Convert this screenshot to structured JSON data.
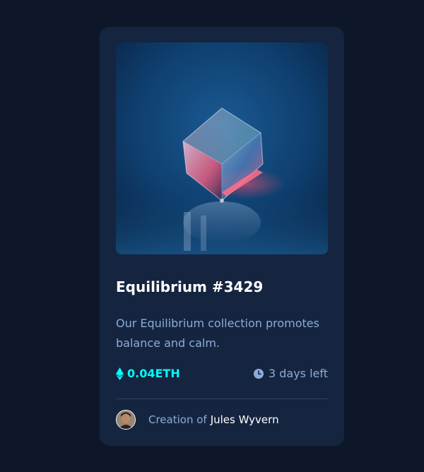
{
  "card": {
    "image_alt": "Equilibrium",
    "title": "Equilibrium #3429",
    "description": "Our Equilibrium collection promotes balance and calm.",
    "price": "0.04ETH",
    "time_left": "3 days left",
    "creator_prefix": "Creation of",
    "creator_name": "Jules Wyvern"
  },
  "icons": {
    "price": "ethereum-icon",
    "time": "clock-icon",
    "avatar": "avatar"
  },
  "colors": {
    "page_bg": "#0e1729",
    "card_bg": "#15253f",
    "cyan": "#00fff8",
    "soft_blue": "#8bacd9",
    "white": "#ffffff",
    "divider": "#2e405a"
  }
}
